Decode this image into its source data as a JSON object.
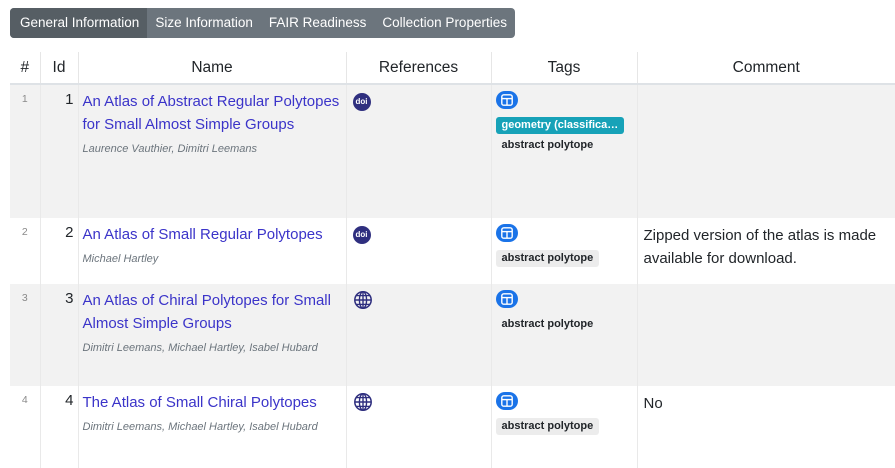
{
  "tabs": [
    {
      "label": "General Information",
      "active": true
    },
    {
      "label": "Size Information",
      "active": false
    },
    {
      "label": "FAIR Readiness",
      "active": false
    },
    {
      "label": "Collection Properties",
      "active": false
    }
  ],
  "table": {
    "headers": [
      "#",
      "Id",
      "Name",
      "References",
      "Tags",
      "Comment"
    ],
    "rows": [
      {
        "rownum": "1",
        "id": "1",
        "name": "An Atlas of Abstract Regular Polytopes for Small Almost Simple Groups",
        "authors": [
          "Laurence Vauthier",
          "Dimitri Leemans"
        ],
        "ref_icon": "doi-icon",
        "ref_text": "doi",
        "tags": [
          "geometry (classifica…",
          "abstract polytope"
        ],
        "comment": ""
      },
      {
        "rownum": "2",
        "id": "2",
        "name": "An Atlas of Small Regular Polytopes",
        "authors": [
          "Michael Hartley"
        ],
        "ref_icon": "doi-icon",
        "ref_text": "doi",
        "tags": [
          "abstract polytope"
        ],
        "comment": "Zipped version of the atlas is made available for download."
      },
      {
        "rownum": "3",
        "id": "3",
        "name": "An Atlas of Chiral Polytopes for Small Almost Simple Groups",
        "authors": [
          "Dimitri Leemans",
          "Michael Hartley",
          "Isabel Hubard"
        ],
        "ref_icon": "globe-icon",
        "ref_text": "",
        "tags": [
          "abstract polytope"
        ],
        "comment": ""
      },
      {
        "rownum": "4",
        "id": "4",
        "name": "The Atlas of Small Chiral Polytopes",
        "authors": [
          "Dimitri Leemans",
          "Michael Hartley",
          "Isabel Hubard"
        ],
        "ref_icon": "globe-icon",
        "ref_text": "",
        "tags": [
          "abstract polytope"
        ],
        "comment": "No"
      }
    ]
  },
  "colors": {
    "tab_bg": "#6c757d",
    "tab_active": "#565e64",
    "link": "#3b34c9",
    "tag_teal": "#17a2b8",
    "tag_icon": "#1a73e8",
    "doi": "#2f2f7f"
  }
}
